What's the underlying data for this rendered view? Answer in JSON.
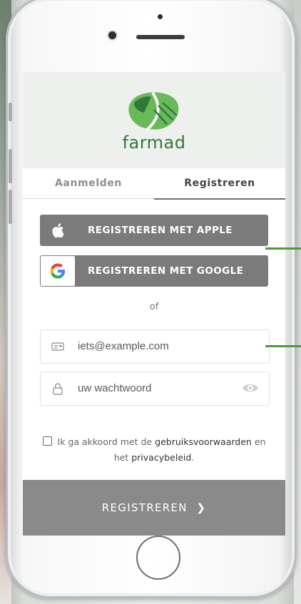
{
  "brand": {
    "name": "farmad",
    "logo_icon": "farmad-leaf-logo",
    "colors": {
      "green": "#2f7a3a",
      "light_green": "#69b85a"
    }
  },
  "tabs": [
    {
      "label": "Aanmelden",
      "active": false
    },
    {
      "label": "Registreren",
      "active": true
    }
  ],
  "social": {
    "apple": {
      "label": "REGISTREREN MET APPLE",
      "icon": "apple-icon"
    },
    "google": {
      "label": "REGISTREREN MET GOOGLE",
      "icon": "google-icon"
    }
  },
  "separator": "of",
  "form": {
    "email": {
      "placeholder": "iets@example.com",
      "value": "",
      "icon": "email-card-icon"
    },
    "password": {
      "placeholder": "uw wachtwoord",
      "value": "",
      "icon": "lock-icon",
      "toggle_icon": "eye-icon"
    }
  },
  "agreement": {
    "prefix": "Ik ga akkoord met de",
    "terms_link": "gebruiksvoorwaarden",
    "conjunction": "en",
    "line2_prefix": "het",
    "privacy_link": "privacybeleid",
    "suffix": ".",
    "checked": false
  },
  "submit": {
    "label": "REGISTREREN",
    "icon": "chevron-right-icon"
  },
  "colors": {
    "button_gray": "#7b7b7b",
    "submit_gray": "#8a8a8a",
    "callout_green": "#4f9a3b"
  }
}
